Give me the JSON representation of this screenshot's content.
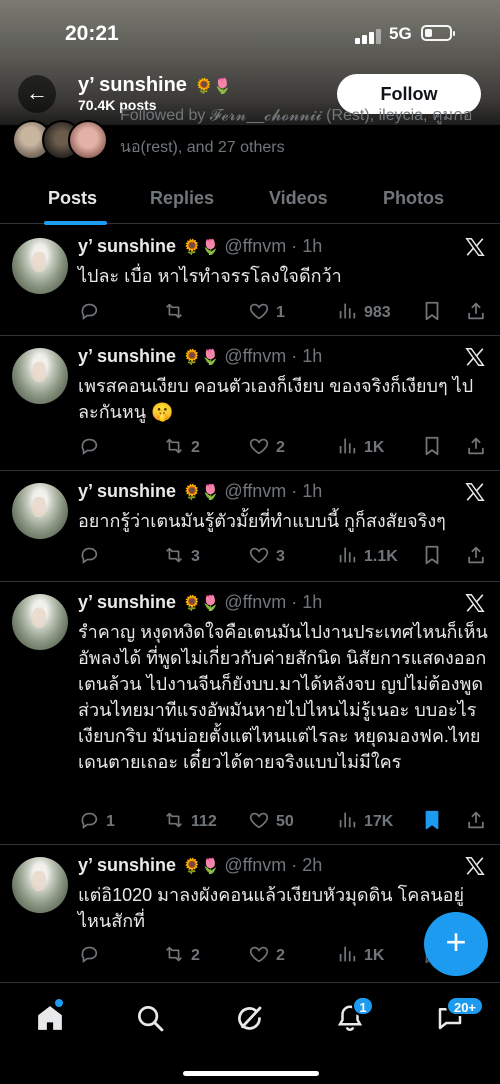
{
  "status_bar": {
    "time": "20:21",
    "network": "5G"
  },
  "header": {
    "name": "y’ sunshine",
    "name_emoji": "🌻🌷",
    "posts_count": "70.4K posts",
    "follow_label": "Follow",
    "followed_by": "Followed by 𝓕𝓮𝓻𝓷__𝓬𝓱𝓸𝓷𝓷𝓲𝓲 (Rest), ileycia, คูมกอนอ(rest), and 27 others"
  },
  "tabs": [
    {
      "label": "Posts",
      "active": true
    },
    {
      "label": "Replies",
      "active": false
    },
    {
      "label": "Videos",
      "active": false
    },
    {
      "label": "Photos",
      "active": false
    }
  ],
  "posts": [
    {
      "name": "y’ sunshine",
      "emoji": "🌻🌷",
      "handle": "@ffnvm · 1h",
      "text": "ไปละ เบื่อ หาไรทำจรรโลงใจดีกว้า",
      "reposts": "",
      "likes": "1",
      "views": "983",
      "replies": "",
      "bookmarked": false
    },
    {
      "name": "y’ sunshine",
      "emoji": "🌻🌷",
      "handle": "@ffnvm · 1h",
      "text": "เพรสคอนเงียบ คอนตัวเองก็เงียบ ของจริงก็เงียบๆ ไปละกันหนู 🤫",
      "reposts": "2",
      "likes": "2",
      "views": "1K",
      "replies": "",
      "bookmarked": false
    },
    {
      "name": "y’ sunshine",
      "emoji": "🌻🌷",
      "handle": "@ffnvm · 1h",
      "text": "อยากรู้ว่าเตนมันรู้ตัวมั้ยที่ทำแบบนี้ กูก็สงสัยจริงๆ",
      "reposts": "3",
      "likes": "3",
      "views": "1.1K",
      "replies": "",
      "bookmarked": false
    },
    {
      "name": "y’ sunshine",
      "emoji": "🌻🌷",
      "handle": "@ffnvm · 1h",
      "text": "รำคาญ หงุดหงิดใจคือเตนมันไปงานประเทศไหนก็เห็นอัพลงได้ ที่พูดไม่เกี่ยวกับค่ายสักนิด นิสัยการแสดงออกเตนล้วน ไปงานจีนก็ยังบบ.มาได้หลังจบ ญปไม่ต้องพูด ส่วนไทยมาทีแรงอัพมันหายไปไหนไม่รู้เนอะ บบอะไรเงียบกริบ มันบ่อยตั้งแต่ไหนแต่ไรละ หยุดมองฟค.ไทยเดนตายเถอะ เดี๋ยวได้ตายจริงแบบไม่มีใคร",
      "reposts": "112",
      "likes": "50",
      "views": "17K",
      "replies": "1",
      "bookmarked": true
    },
    {
      "name": "y’ sunshine",
      "emoji": "🌻🌷",
      "handle": "@ffnvm · 2h",
      "text": "แต่อิ1020 มาลงผังคอนแล้วเงียบหัวมุดดิน โคลนอยู่ไหนสักที่",
      "reposts": "2",
      "likes": "2",
      "views": "1K",
      "replies": "",
      "bookmarked": false
    }
  ],
  "fab_label": "+",
  "bottom_nav": {
    "notifications_badge": "1",
    "messages_badge": "20+"
  },
  "colors": {
    "accent": "#1d9bf0",
    "muted": "#71767b",
    "divider": "#2f3336"
  },
  "icons": [
    "back-arrow-icon",
    "x-logo-icon",
    "reply-icon",
    "repost-icon",
    "like-icon",
    "views-icon",
    "bookmark-icon",
    "share-icon",
    "home-icon",
    "search-icon",
    "grok-icon",
    "bell-icon",
    "messages-icon",
    "compose-icon"
  ]
}
